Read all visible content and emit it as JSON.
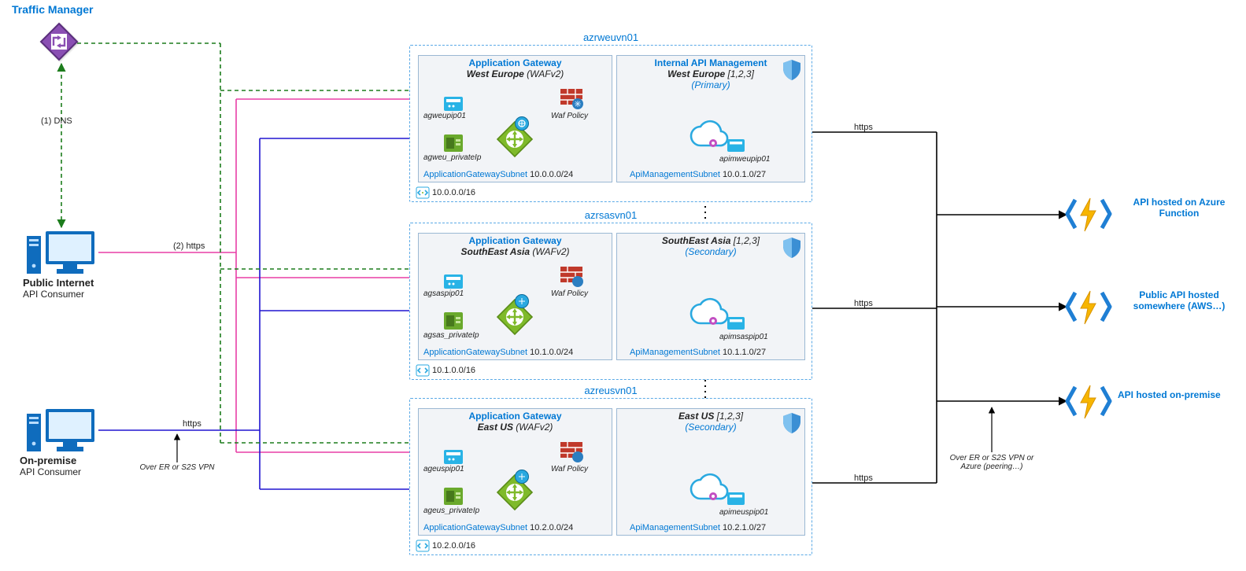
{
  "trafficManager": {
    "label": "Traffic Manager"
  },
  "publicInternet": {
    "title": "Public Internet",
    "subtitle": "API Consumer"
  },
  "onPremise": {
    "title": "On-premise",
    "subtitle": "API Consumer"
  },
  "dnsLabel": "(1) DNS",
  "httpsPublicLabel": "(2) https",
  "httpsOnPremLabel": "https",
  "erNote": "Over ER or S2S VPN",
  "erNoteRight": "Over ER or S2S VPN or\nAzure (peering…)",
  "vnets": {
    "weu": {
      "name": "azrweuvn01",
      "cidr": "10.0.0.0/16",
      "ag": {
        "title": "Application Gateway",
        "region": "West Europe",
        "sku": "(WAFv2)",
        "pip": "agweupip01",
        "privateIp": "agweu_privateIp",
        "waf": "Waf Policy",
        "subnet": "ApplicationGatewaySubnet",
        "subnetCidr": "10.0.0.0/24"
      },
      "apim": {
        "title": "Internal API Management",
        "region": "West Europe",
        "instances": "[1,2,3]",
        "role": "(Primary)",
        "pip": "apimweupip01",
        "subnet": "ApiManagementSubnet",
        "subnetCidr": "10.0.1.0/27"
      }
    },
    "sas": {
      "name": "azrsasvn01",
      "cidr": "10.1.0.0/16",
      "ag": {
        "title": "Application Gateway",
        "region": "SouthEast Asia",
        "sku": "(WAFv2)",
        "pip": "agsaspip01",
        "privateIp": "agsas_privateIp",
        "waf": "Waf Policy",
        "subnet": "ApplicationGatewaySubnet",
        "subnetCidr": "10.1.0.0/24"
      },
      "apim": {
        "region": "SouthEast Asia",
        "instances": "[1,2,3]",
        "role": "(Secondary)",
        "pip": "apimsaspip01",
        "subnet": "ApiManagementSubnet",
        "subnetCidr": "10.1.1.0/27"
      }
    },
    "eus": {
      "name": "azreusvn01",
      "cidr": "10.2.0.0/16",
      "ag": {
        "title": "Application Gateway",
        "region": "East US",
        "sku": "(WAFv2)",
        "pip": "ageuspip01",
        "privateIp": "ageus_privateIp",
        "waf": "Waf Policy",
        "subnet": "ApplicationGatewaySubnet",
        "subnetCidr": "10.2.0.0/24"
      },
      "apim": {
        "region": "East US",
        "instances": "[1,2,3]",
        "role": "(Secondary)",
        "pip": "apimeuspip01",
        "subnet": "ApiManagementSubnet",
        "subnetCidr": "10.2.1.0/27"
      }
    }
  },
  "rightNodes": {
    "azureFunction": "API hosted on Azure Function",
    "publicApi": "Public API hosted somewhere (AWS…)",
    "onPremApi": "API hosted on-premise"
  },
  "httpsLabel": "https"
}
